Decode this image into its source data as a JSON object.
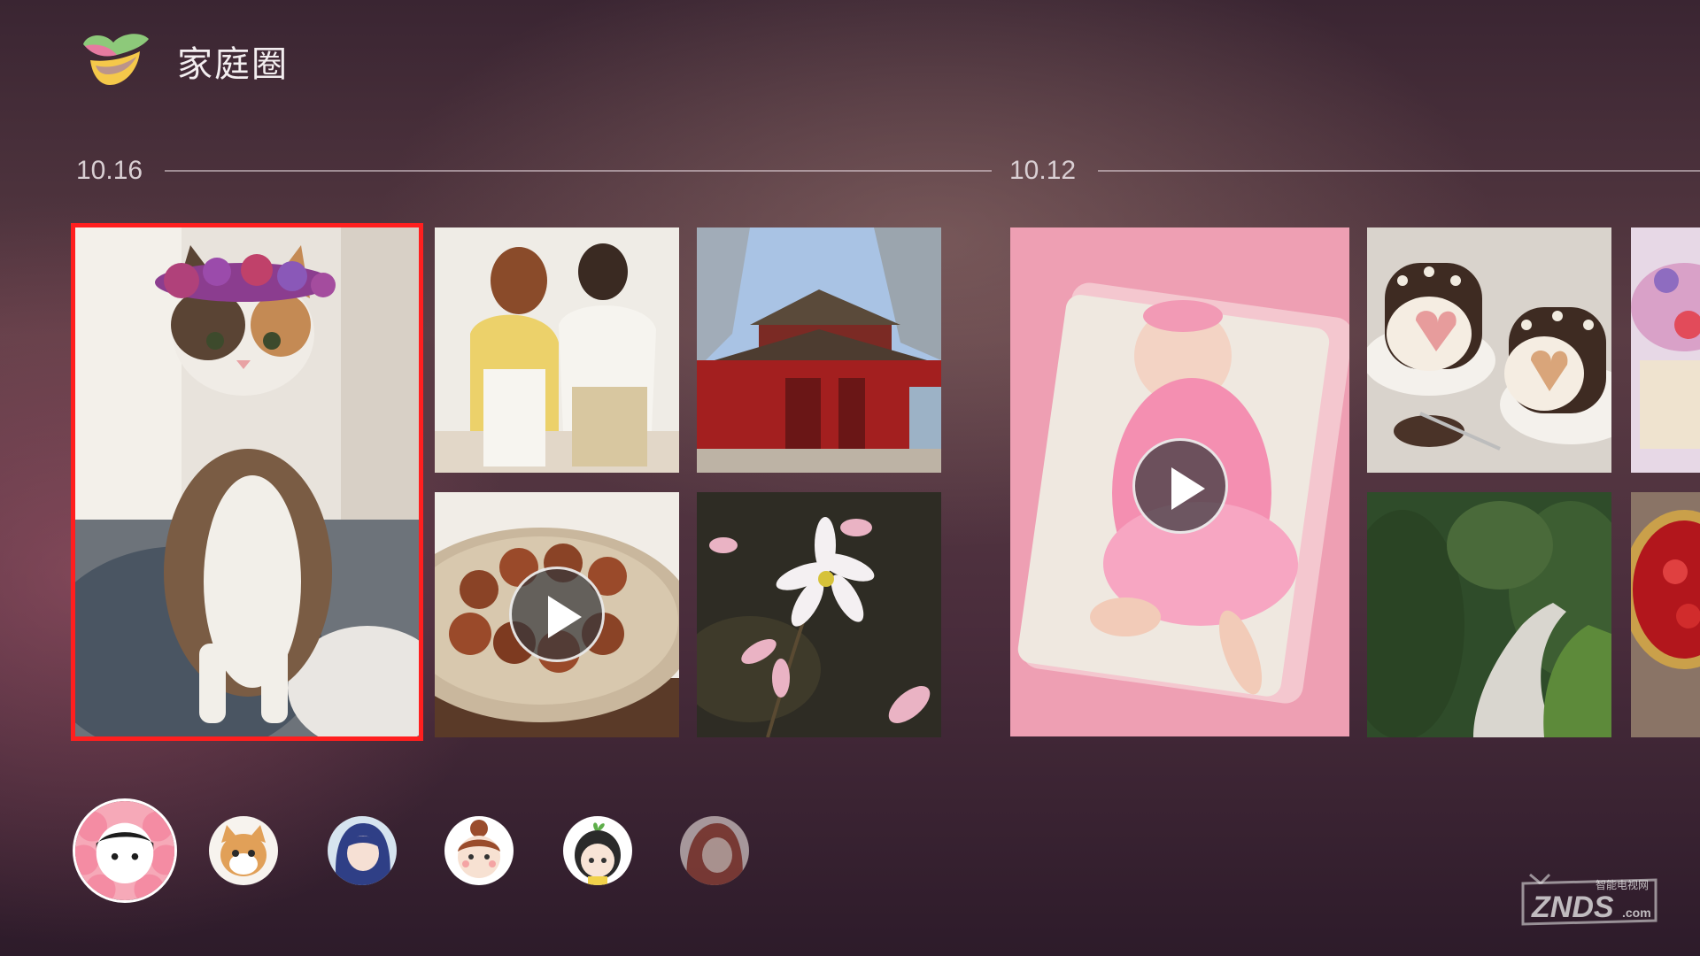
{
  "header": {
    "title": "家庭圈",
    "logo_icon": "heart-ribbon-logo-icon"
  },
  "timeline": {
    "groups": [
      {
        "date": "10.16"
      },
      {
        "date": "10.12"
      }
    ]
  },
  "colors": {
    "focus": "#ff1f1f",
    "text": "#f3eef0"
  },
  "watermark": {
    "brand": "ZNDS",
    "suffix": ".com",
    "tagline": "智能电视网"
  }
}
